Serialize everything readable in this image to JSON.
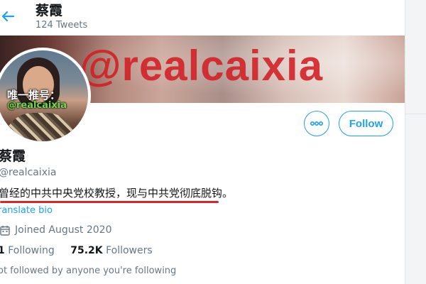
{
  "header": {
    "title": "蔡霞",
    "tweet_count": "124 Tweets"
  },
  "banner": {
    "text": "@realcaixia"
  },
  "avatar": {
    "caption_line1": "唯一推号：",
    "caption_line2": "@realcaixia"
  },
  "actions": {
    "follow_label": "Follow"
  },
  "profile": {
    "name": "蔡霞",
    "handle": "@realcaixia",
    "bio": "曾经的中共中央党校教授，现与中共党彻底脱钩。",
    "translate_label": "ranslate bio",
    "joined": "Joined August 2020",
    "following_count": "1",
    "following_label": "Following",
    "followers_count": "75.2K",
    "followers_label": "Followers",
    "not_followed_text": "ot followed by anyone you're following"
  },
  "colors": {
    "accent": "#1da1f2",
    "highlight_underline": "#d9262b",
    "secondary_text": "#657786",
    "primary_text": "#14171a"
  },
  "icons": {
    "back": "back-arrow-icon",
    "more": "more-dots-icon",
    "joined": "calendar-icon"
  }
}
